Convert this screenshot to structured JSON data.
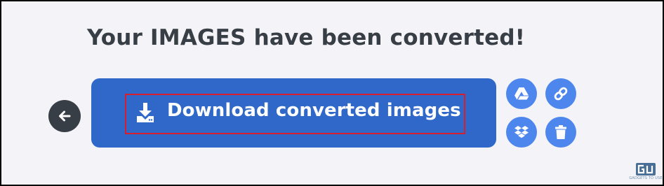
{
  "heading": "Your IMAGES have been converted!",
  "download_button": {
    "label": "Download converted images",
    "icon": "download-icon"
  },
  "back_button": {
    "icon": "arrow-left-icon"
  },
  "share_buttons": [
    {
      "name": "google-drive",
      "icon": "google-drive-icon"
    },
    {
      "name": "copy-link",
      "icon": "link-icon"
    },
    {
      "name": "dropbox",
      "icon": "dropbox-icon"
    },
    {
      "name": "delete",
      "icon": "trash-icon"
    }
  ],
  "watermark": {
    "logo_text": "GU",
    "tagline": "GADGETS TO USE"
  },
  "colors": {
    "primary_button": "#2f68c9",
    "secondary_circle": "#4d86ec",
    "back_button": "#383e45",
    "highlight_box": "#d81e2a",
    "background": "#f4f4f8",
    "heading_text": "#383e45"
  }
}
